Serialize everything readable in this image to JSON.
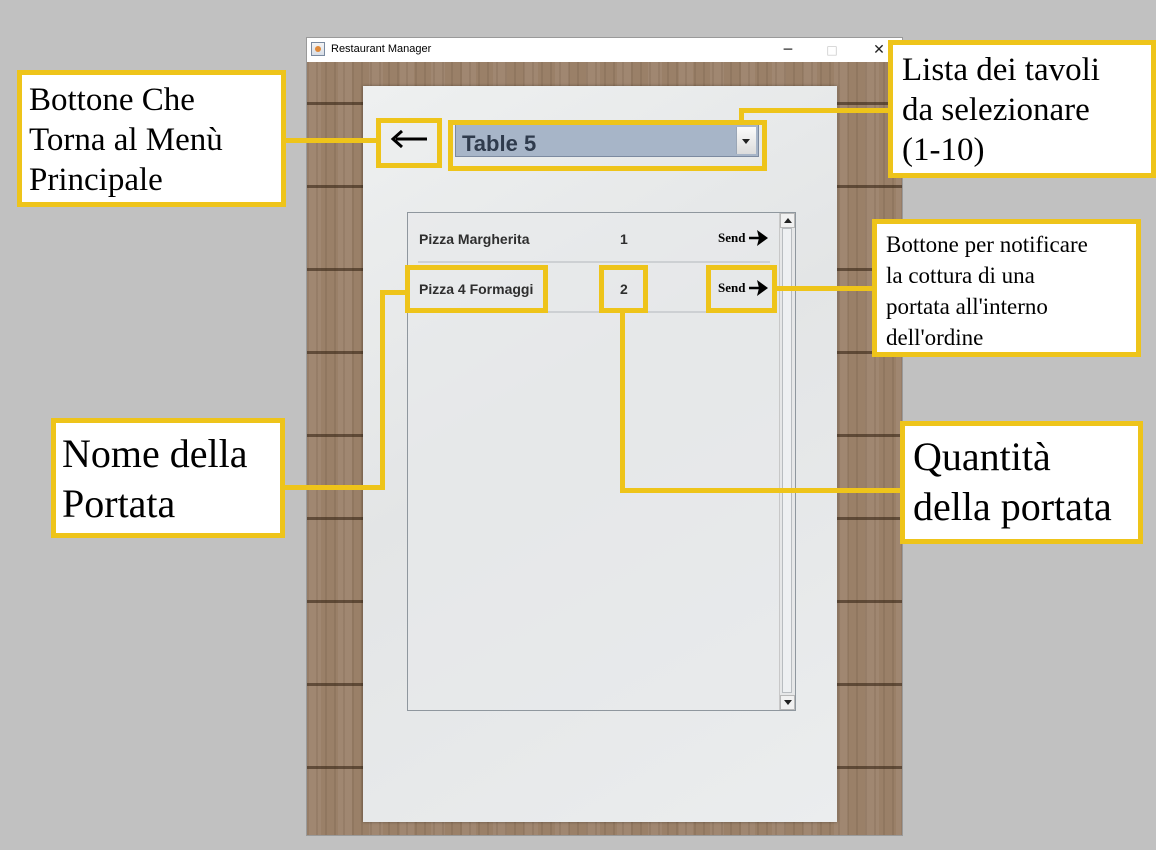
{
  "window": {
    "title": "Restaurant Manager",
    "minimize_glyph": "─",
    "maximize_glyph": "□",
    "close_glyph": "✕"
  },
  "back_button": {
    "icon": "arrow-left-icon"
  },
  "table_selector": {
    "selected": "Table 5"
  },
  "order_items": [
    {
      "name": "Pizza Margherita",
      "quantity": "1",
      "send_label": "Send"
    },
    {
      "name": "Pizza 4 Formaggi",
      "quantity": "2",
      "send_label": "Send"
    }
  ],
  "annotations": {
    "back_button": "Bottone Che\nTorna al Menù\nPrincipale",
    "table_list": "Lista dei tavoli\nda selezionare\n(1-10)",
    "send_button": "Bottone per notificare\nla cottura di una\nportata all'interno\ndell'ordine",
    "dish_name": "Nome della\nPortata",
    "dish_quantity": "Quantità\ndella portata"
  },
  "colors": {
    "highlight": "#eec41a",
    "combo_bg": "#a7b5c8",
    "page_bg": "#c1c1c1"
  }
}
